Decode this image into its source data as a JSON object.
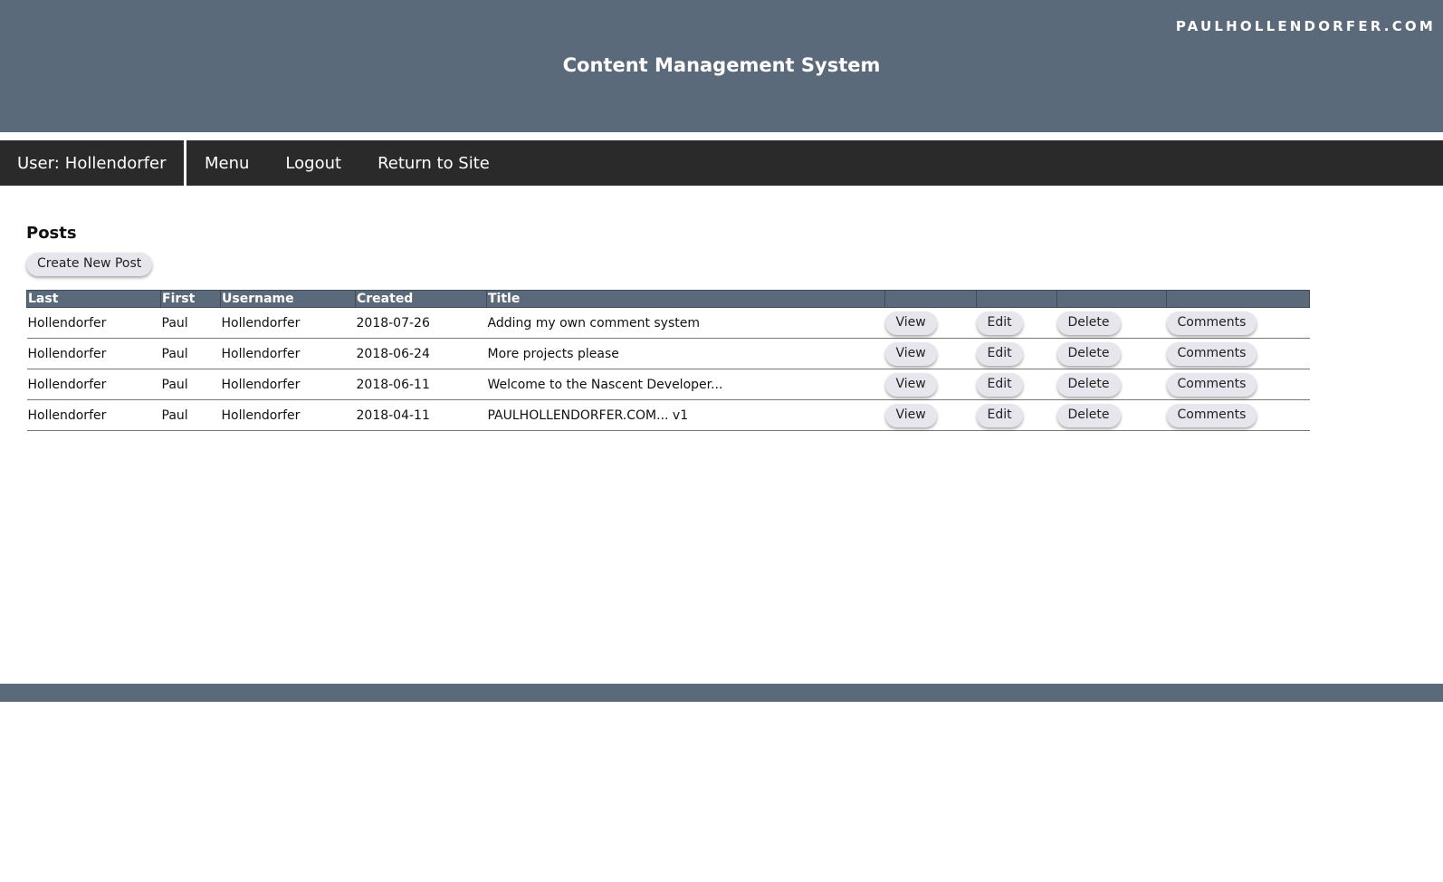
{
  "header": {
    "site_name": "PAULHOLLENDORFER.COM",
    "app_title": "Content Management System"
  },
  "navbar": {
    "user_prefix": "User:",
    "user_name": "Hollendorfer",
    "links": [
      "Menu",
      "Logout",
      "Return to Site"
    ]
  },
  "posts": {
    "section_title": "Posts",
    "create_label": "Create New Post",
    "columns": [
      "Last",
      "First",
      "Username",
      "Created",
      "Title",
      "",
      "",
      "",
      ""
    ],
    "action_labels": {
      "view": "View",
      "edit": "Edit",
      "delete": "Delete",
      "comments": "Comments"
    },
    "rows": [
      {
        "last": "Hollendorfer",
        "first": "Paul",
        "username": "Hollendorfer",
        "created": "2018-07-26",
        "title": "Adding my own comment system"
      },
      {
        "last": "Hollendorfer",
        "first": "Paul",
        "username": "Hollendorfer",
        "created": "2018-06-24",
        "title": "More projects please"
      },
      {
        "last": "Hollendorfer",
        "first": "Paul",
        "username": "Hollendorfer",
        "created": "2018-06-11",
        "title": "Welcome to the Nascent Developer..."
      },
      {
        "last": "Hollendorfer",
        "first": "Paul",
        "username": "Hollendorfer",
        "created": "2018-04-11",
        "title": "PAULHOLLENDORFER.COM... v1"
      }
    ]
  },
  "colors": {
    "header_bg": "#5b6a7b",
    "navbar_bg": "#2a2a2a",
    "button_bg": "#e6e6ec"
  }
}
